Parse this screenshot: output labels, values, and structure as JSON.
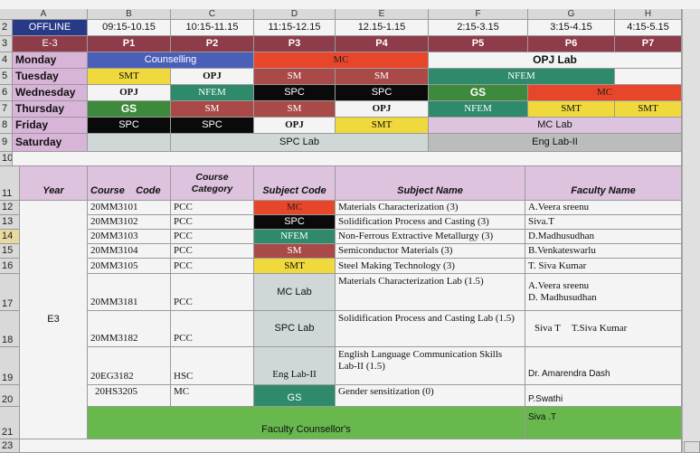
{
  "columns": [
    "A",
    "B",
    "C",
    "D",
    "E",
    "F",
    "G",
    "H"
  ],
  "rows": {
    "r2": {
      "num": "2",
      "a": "OFFLINE",
      "t1": "09:15-10.15",
      "t2": "10:15-11.15",
      "t3": "11:15-12.15",
      "t4": "12.15-1.15",
      "t5": "2:15-3.15",
      "t6": "3:15-4.15",
      "t7": "4:15-5.15"
    },
    "r3": {
      "num": "3",
      "a": "E-3",
      "p1": "P1",
      "p2": "P2",
      "p3": "P3",
      "p4": "P4",
      "p5": "P5",
      "p6": "P6",
      "p7": "P7"
    },
    "r4": {
      "num": "4",
      "day": "Monday",
      "counselling": "Counselling",
      "mc": "MC",
      "opjlab": "OPJ Lab"
    },
    "r5": {
      "num": "5",
      "day": "Tuesday",
      "smt": "SMT",
      "opj": "OPJ",
      "sm": "SM",
      "sm2": "SM",
      "nfem": "NFEM"
    },
    "r6": {
      "num": "6",
      "day": "Wednesday",
      "opj": "OPJ",
      "nfem": "NFEM",
      "spc": "SPC",
      "spc2": "SPC",
      "gs": "GS",
      "mc": "MC"
    },
    "r7": {
      "num": "7",
      "day": "Thursday",
      "gs": "GS",
      "sm": "SM",
      "sm2": "SM",
      "opj": "OPJ",
      "nfem": "NFEM",
      "smt": "SMT",
      "smt2": "SMT"
    },
    "r8": {
      "num": "8",
      "day": "Friday",
      "spc": "SPC",
      "spc2": "SPC",
      "opj": "OPJ",
      "smt": "SMT",
      "mclab": "MC Lab"
    },
    "r9": {
      "num": "9",
      "day": "Saturday",
      "spclab": "SPC Lab",
      "englab": "Eng Lab-II"
    },
    "r10": {
      "num": "10"
    },
    "r11": {
      "num": "11",
      "year": "Year",
      "course_code": "Course    Code",
      "course_category": "Course\nCategory",
      "subject_code": "Subject Code",
      "subject_name": "Subject Name",
      "faculty_name": "Faculty Name"
    },
    "r21": {
      "counsellor_label": "Faculty Counsellor's",
      "counsellor": "Siva .T"
    },
    "r22": {
      "num": "21"
    },
    "r23": {
      "num": "23"
    }
  },
  "e3": "E3",
  "subjects": [
    {
      "num": "12",
      "code": "20MM3101",
      "cat": "PCC",
      "sub": "MC",
      "name": "Materials Characterization (3)",
      "faculty": "A.Veera sreenu"
    },
    {
      "num": "13",
      "code": "20MM3102",
      "cat": "PCC",
      "sub": "SPC",
      "name": "Solidification Process and Casting (3)",
      "faculty": "Siva.T"
    },
    {
      "num": "14",
      "code": "20MM3103",
      "cat": "PCC",
      "sub": "NFEM",
      "name": "Non-Ferrous Extractive Metallurgy (3)",
      "faculty": "D.Madhusudhan"
    },
    {
      "num": "15",
      "code": "20MM3104",
      "cat": "PCC",
      "sub": "SM",
      "name": "Semiconductor Materials (3)",
      "faculty": "B.Venkateswarlu"
    },
    {
      "num": "16",
      "code": "20MM3105",
      "cat": "PCC",
      "sub": "SMT",
      "name": "Steel Making Technology (3)",
      "faculty": "T. Siva Kumar"
    }
  ],
  "labs": [
    {
      "num": "17",
      "code": "20MM3181",
      "cat": "PCC",
      "sub": "MC Lab",
      "name": "Materials Characterization Lab (1.5)",
      "faculty1": "A.Veera sreenu",
      "faculty2": "D. Madhusudhan"
    },
    {
      "num": "18",
      "code": "20MM3182",
      "cat": "PCC",
      "sub": "SPC Lab",
      "name": "Solidification Process and Casting Lab (1.5)",
      "faculty1": "Siva T",
      "faculty2": "T.Siva Kumar"
    },
    {
      "num": "19",
      "code": "20EG3182",
      "cat": "HSC",
      "sub": "Eng Lab-II",
      "name": "English Language Communication Skills Lab-II (1.5)",
      "faculty1": "Dr. Amarendra Dash"
    },
    {
      "num": "20",
      "code": "20HS3205",
      "cat": "MC",
      "sub": "GS",
      "name": "Gender sensitization (0)",
      "faculty1": "P.Swathi"
    }
  ],
  "colors": {
    "offline": "#283a86",
    "period": "#8e3b4a",
    "mc": "#e8462a",
    "smt": "#f0d93c",
    "gs": "#3d8a3c",
    "spc": "#0a0a0a",
    "sm": "#a94a48",
    "nfem": "#2e8a6a"
  }
}
